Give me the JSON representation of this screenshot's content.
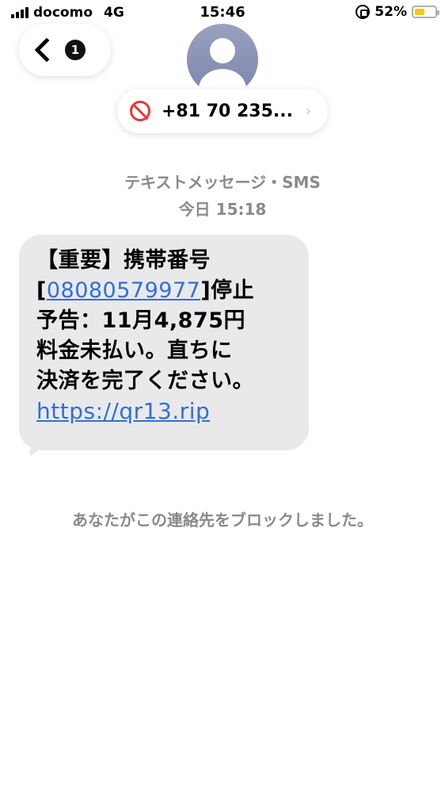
{
  "status_bar": {
    "carrier": "docomo",
    "network": "4G",
    "time": "15:46",
    "battery_percent": "52%",
    "battery_level": 0.52
  },
  "nav": {
    "back_badge": "1"
  },
  "contact": {
    "number": "+81 70 235...",
    "chevron": "›"
  },
  "conversation": {
    "type_label": "テキストメッセージ・SMS",
    "timestamp": "今日 15:18"
  },
  "message": {
    "line1": "【重要】携帯番号",
    "line2_prefix": "[",
    "line2_phone": "08080579977",
    "line2_suffix": "]停止",
    "line3": "予告：11月4,875円",
    "line4": "料金未払い。直ちに",
    "line5": "決済を完了ください。",
    "url": "https://qr13.rip"
  },
  "notice": {
    "blocked": "あなたがこの連絡先をブロックしました。"
  },
  "colors": {
    "link": "#2f6fd6",
    "block_icon": "#e53935",
    "bubble": "#e9e9eb",
    "muted_text": "#8a8a8e",
    "battery_fill": "#f5c518"
  },
  "icons": [
    "signal-icon",
    "orientation-lock-icon",
    "battery-icon",
    "back-chevron-icon",
    "avatar-icon",
    "block-icon",
    "chevron-right-icon"
  ]
}
